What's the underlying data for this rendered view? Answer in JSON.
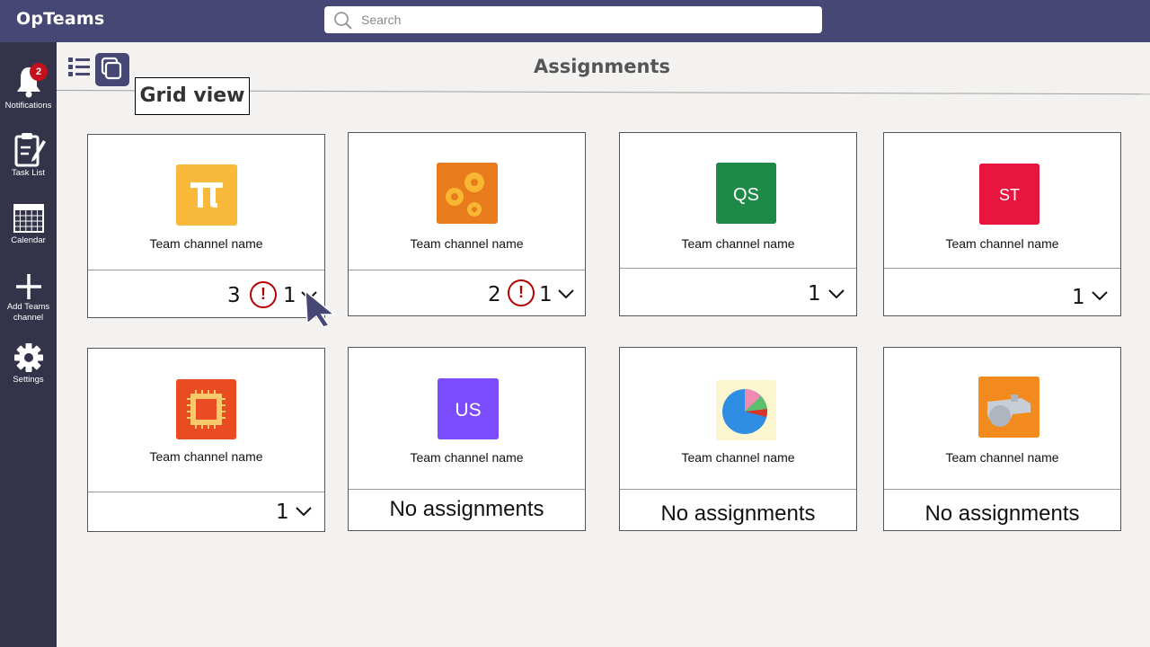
{
  "app": {
    "title": "OpTeams"
  },
  "search": {
    "placeholder": "Search"
  },
  "sidebar": {
    "items": [
      {
        "label": "Notifications",
        "badge": "2"
      },
      {
        "label": "Task List"
      },
      {
        "label": "Calendar"
      },
      {
        "label": "Add Teams channel"
      },
      {
        "label": "Settings"
      }
    ]
  },
  "page": {
    "title": "Assignments"
  },
  "tooltip": {
    "text": "Grid view"
  },
  "cards": [
    {
      "name": "Team channel name",
      "count": "3",
      "alert": "!",
      "alert_count": "1",
      "logo": "pi-icon",
      "color": "#f9b93b"
    },
    {
      "name": "Team channel name",
      "count": "2",
      "alert": "!",
      "alert_count": "1",
      "logo": "gears-icon",
      "color": "#e87b1b"
    },
    {
      "name": "Team channel name",
      "count": "1",
      "logo_text": "QS",
      "color": "#1f8a47"
    },
    {
      "name": "Team channel name",
      "count": "1",
      "logo_text": "ST",
      "color": "#e8163f"
    },
    {
      "name": "Team channel name",
      "count": "1",
      "logo": "circuit-icon",
      "color": "#e94c23"
    },
    {
      "name": "Team channel name",
      "status": "No assignments",
      "logo_text": "US",
      "color": "#7c4dff"
    },
    {
      "name": "Team channel name",
      "status": "No assignments",
      "logo": "pie-chart-icon",
      "color": "#fbf6cf"
    },
    {
      "name": "Team channel name",
      "status": "No assignments",
      "logo": "whistle-icon",
      "color": "#f28a1e"
    }
  ]
}
